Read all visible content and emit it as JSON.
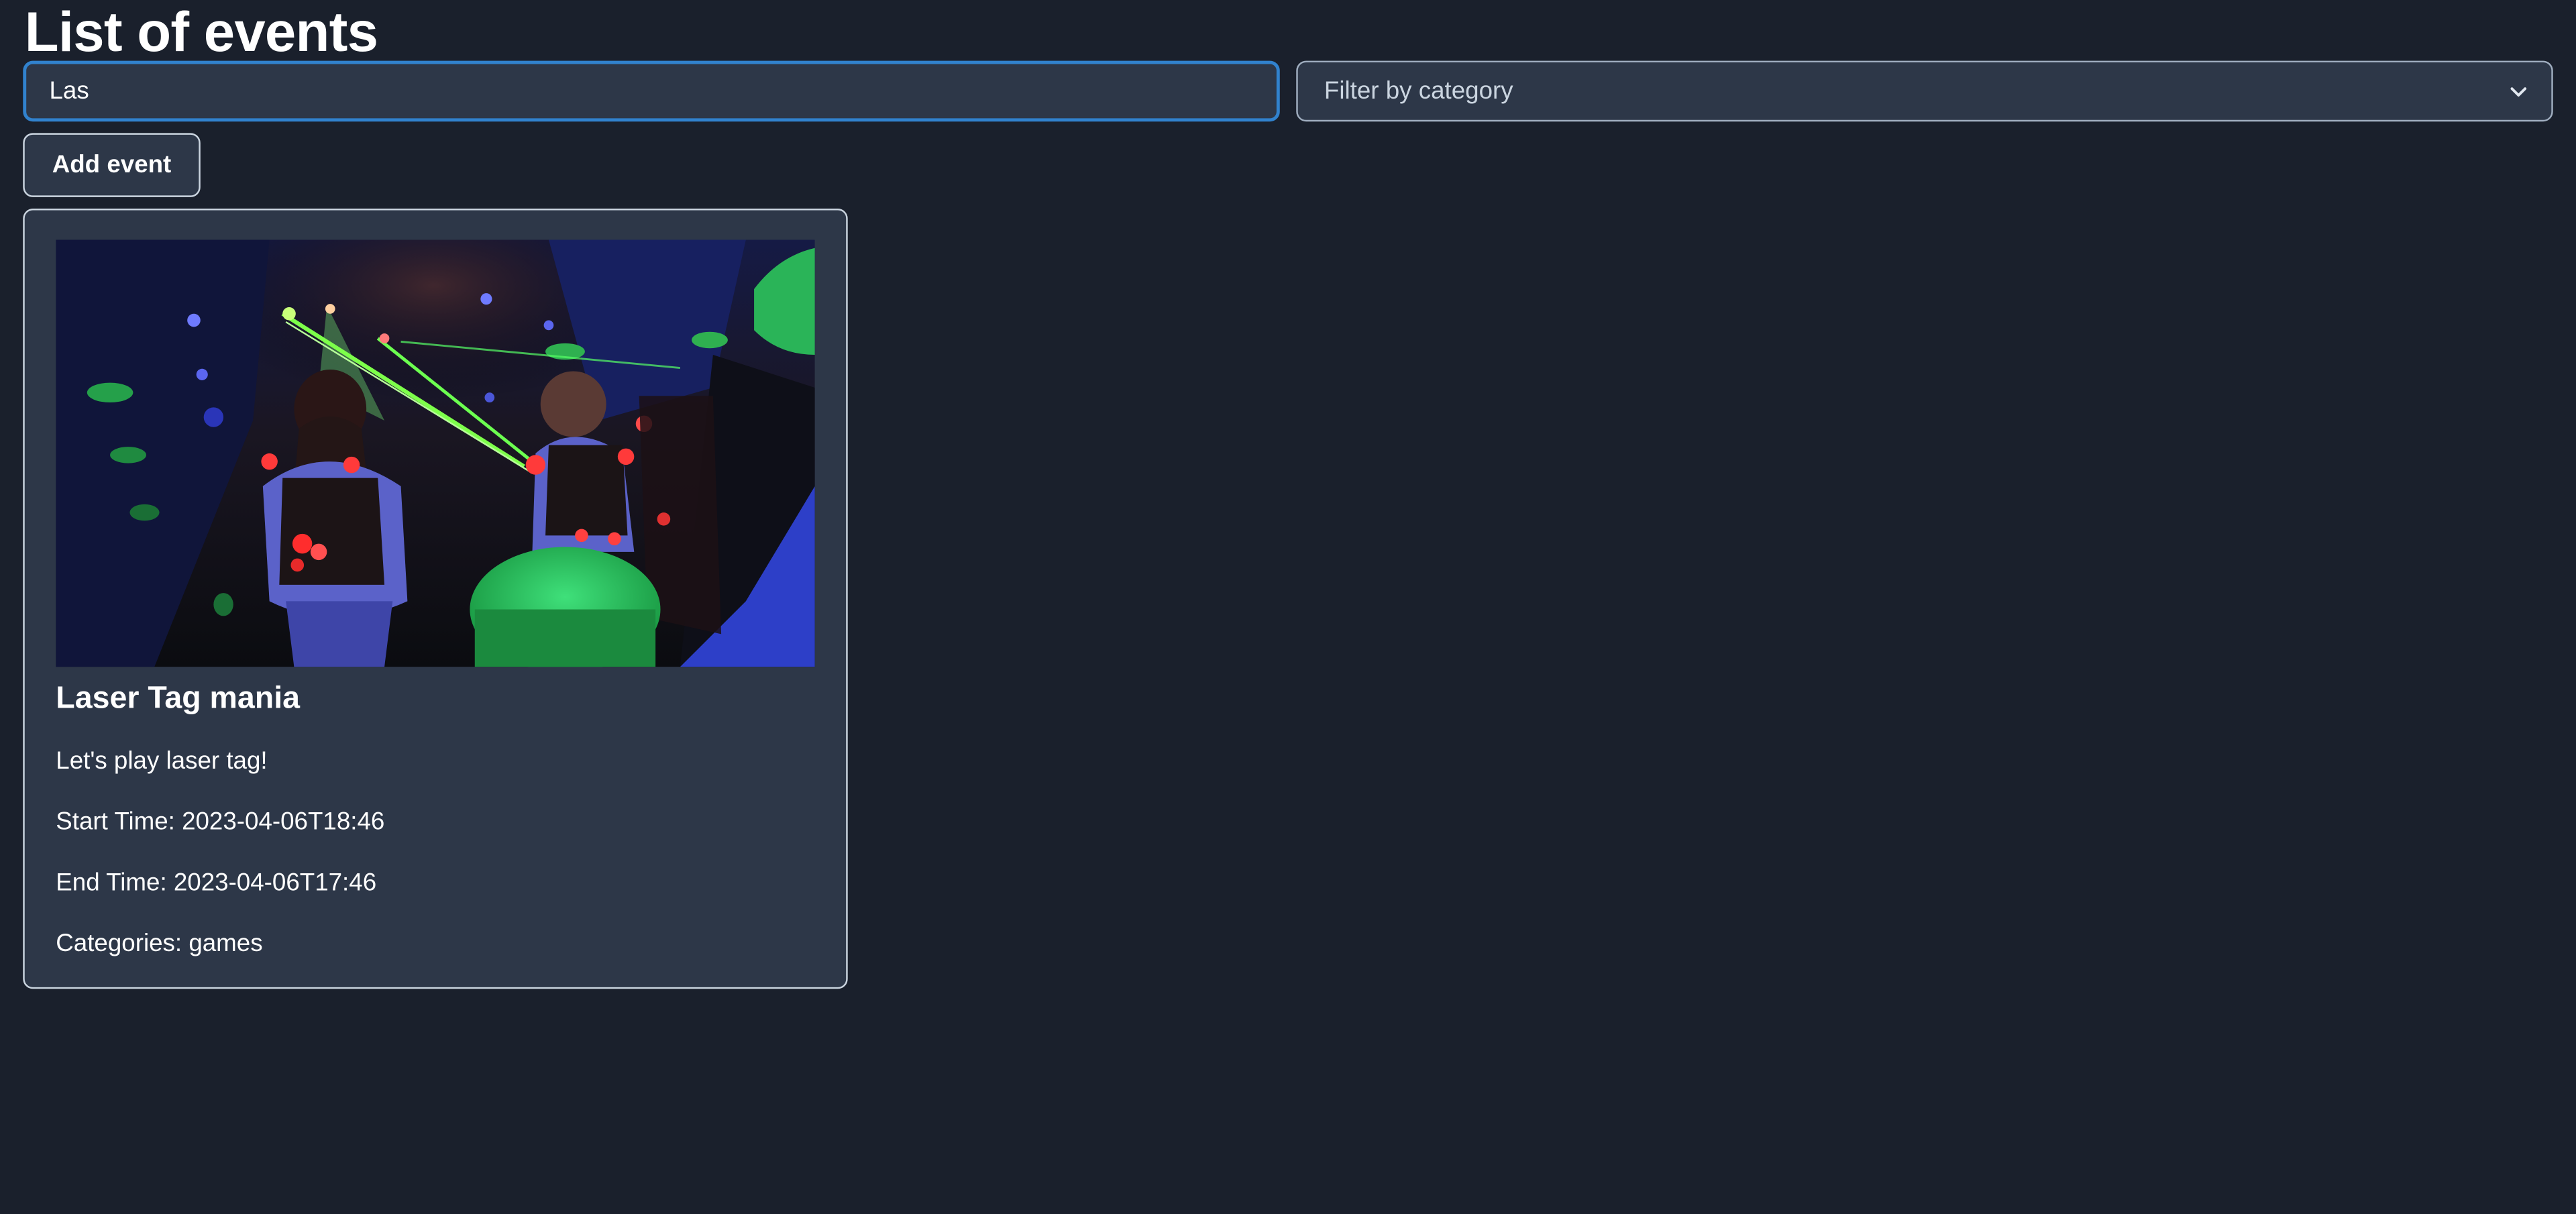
{
  "page": {
    "title": "List of events"
  },
  "search": {
    "value": "Las"
  },
  "category_filter": {
    "placeholder": "Filter by category",
    "icon": "chevron-down-icon"
  },
  "add_event": {
    "label": "Add event"
  },
  "colors": {
    "background": "#1a202c",
    "card": "#2d3748",
    "focus_border": "#3182ce",
    "text": "#ffffff"
  },
  "events": [
    {
      "title": "Laser Tag mania",
      "description": "Let's play laser tag!",
      "start_time_text": "Start Time: 2023-04-06T18:46",
      "end_time_text": "End Time: 2023-04-06T17:46",
      "categories_text": "Categories: games"
    }
  ]
}
